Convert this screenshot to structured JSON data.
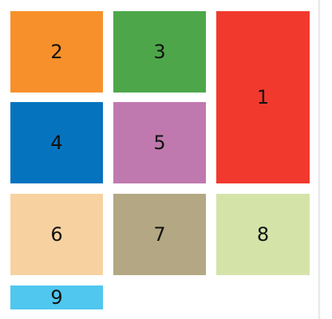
{
  "tiles": [
    {
      "label": "2",
      "color": "#F7902A"
    },
    {
      "label": "3",
      "color": "#4DA74A"
    },
    {
      "label": "1",
      "color": "#F2392E"
    },
    {
      "label": "4",
      "color": "#0673BF"
    },
    {
      "label": "5",
      "color": "#C079AE"
    },
    {
      "label": "6",
      "color": "#F7D2A0"
    },
    {
      "label": "7",
      "color": "#B3A883"
    },
    {
      "label": "8",
      "color": "#D4E4A9"
    },
    {
      "label": "9",
      "color": "#4FC7EE"
    }
  ]
}
